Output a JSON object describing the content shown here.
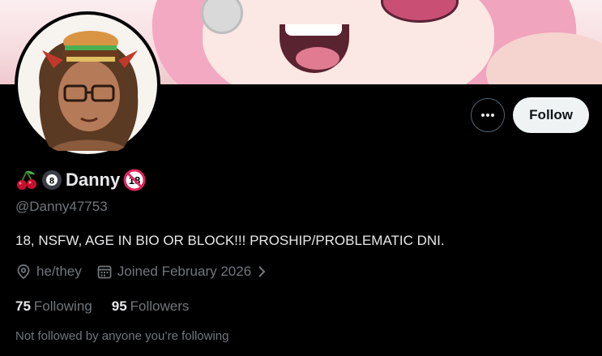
{
  "profile": {
    "emoji_prefix": [
      "cherries",
      "8-ball"
    ],
    "display_name": "Danny",
    "name_suffix_badge": "18",
    "handle": "@Danny47753",
    "bio": "18, NSFW, AGE IN BIO OR BLOCK!!! PROSHIP/PROBLEMATIC DNI.",
    "pronouns": "he/they",
    "joined": "Joined February 2026",
    "following_count": "75",
    "following_label": "Following",
    "followers_count": "95",
    "followers_label": "Followers",
    "social_note": "Not followed by anyone you’re following"
  },
  "actions": {
    "more_icon": "more-dots-icon",
    "follow_label": "Follow"
  },
  "colors": {
    "background": "#000000",
    "primary_text": "#e7e9ea",
    "secondary_text": "#71767b",
    "follow_button_bg": "#eff3f4",
    "badge_red": "#e0245e"
  },
  "icons": {
    "location": "location-pin-icon",
    "calendar": "calendar-icon",
    "chevron": "chevron-right-icon"
  }
}
